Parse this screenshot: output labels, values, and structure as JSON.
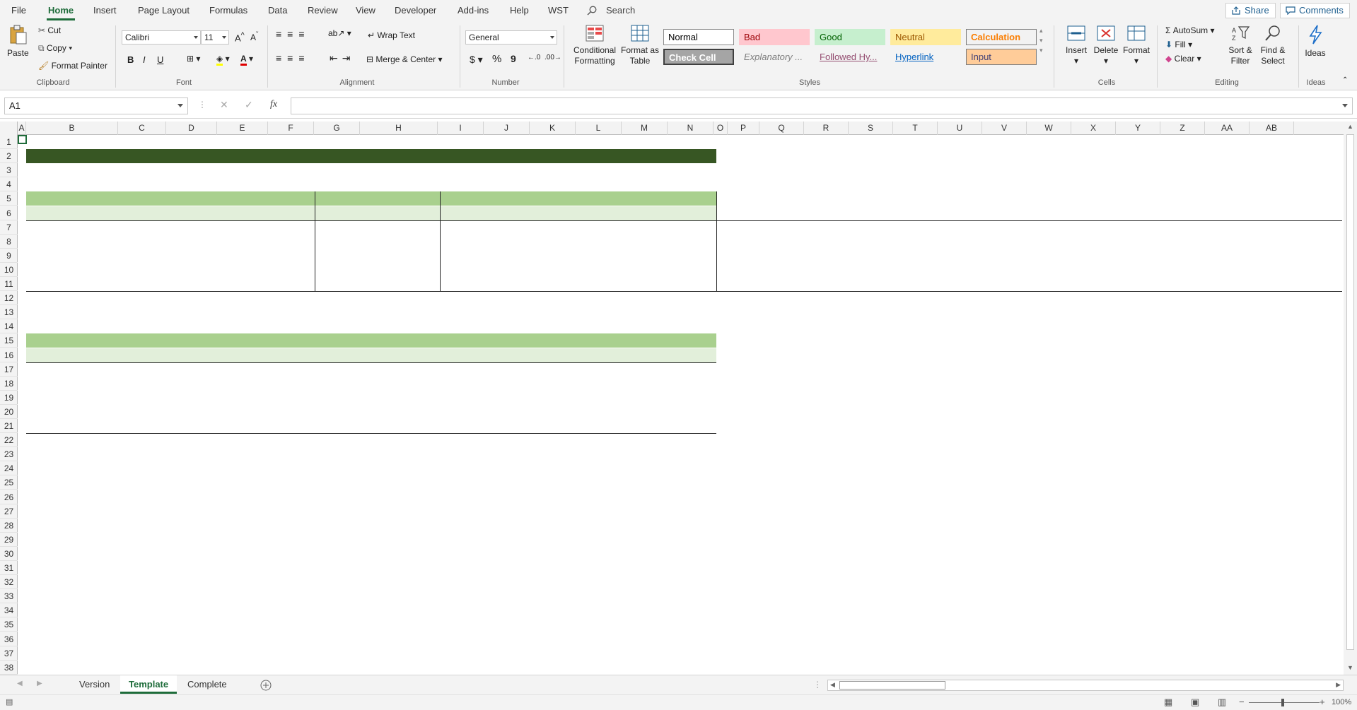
{
  "menu": {
    "items": [
      "File",
      "Home",
      "Insert",
      "Page Layout",
      "Formulas",
      "Data",
      "Review",
      "View",
      "Developer",
      "Add-ins",
      "Help",
      "WST"
    ],
    "active": "Home",
    "search_label": "Search",
    "share_label": "Share",
    "comments_label": "Comments"
  },
  "ribbon": {
    "clipboard": {
      "label": "Clipboard",
      "paste": "Paste",
      "cut": "Cut",
      "copy": "Copy",
      "format_painter": "Format Painter"
    },
    "font": {
      "label": "Font",
      "family": "Calibri",
      "size": "11",
      "bold": "B",
      "italic": "I",
      "underline": "U"
    },
    "alignment": {
      "label": "Alignment",
      "wrap_text": "Wrap Text",
      "merge_center": "Merge & Center"
    },
    "number": {
      "label": "Number",
      "format": "General",
      "currency": "$",
      "percent": "%",
      "comma": "9"
    },
    "styles": {
      "label": "Styles",
      "conditional_formatting": [
        "Conditional",
        "Formatting"
      ],
      "format_as_table": [
        "Format as",
        "Table"
      ],
      "cells": [
        {
          "name": "Normal",
          "bg": "#ffffff",
          "fg": "#000000"
        },
        {
          "name": "Bad",
          "bg": "#ffc7ce",
          "fg": "#9c0006"
        },
        {
          "name": "Good",
          "bg": "#c6efce",
          "fg": "#006100"
        },
        {
          "name": "Neutral",
          "bg": "#ffeb9c",
          "fg": "#9c5700"
        },
        {
          "name": "Calculation",
          "bg": "#f2f2f2",
          "fg": "#fa7d00"
        },
        {
          "name": "Check Cell",
          "bg": "#a5a5a5",
          "fg": "#ffffff"
        },
        {
          "name": "Explanatory ...",
          "bg": "#f3f3f3",
          "fg": "#7f7f7f"
        },
        {
          "name": "Followed Hy...",
          "bg": "#f3f3f3",
          "fg": "#954f72"
        },
        {
          "name": "Hyperlink",
          "bg": "#f3f3f3",
          "fg": "#0563c1"
        },
        {
          "name": "Input",
          "bg": "#ffcc99",
          "fg": "#3f3f76"
        }
      ]
    },
    "cells": {
      "label": "Cells",
      "insert": "Insert",
      "delete": "Delete",
      "format": "Format"
    },
    "editing": {
      "label": "Editing",
      "autosum": "AutoSum",
      "fill": "Fill",
      "clear": "Clear",
      "sort_filter": [
        "Sort &",
        "Filter"
      ],
      "find_select": [
        "Find &",
        "Select"
      ]
    },
    "ideas": {
      "label": "Ideas",
      "button": "Ideas"
    }
  },
  "formula_bar": {
    "name_box": "A1",
    "fx": "fx",
    "content": ""
  },
  "sheet": {
    "columns": [
      "A",
      "B",
      "C",
      "D",
      "E",
      "F",
      "G",
      "H",
      "I",
      "J",
      "K",
      "L",
      "M",
      "N",
      "O",
      "P",
      "Q",
      "R",
      "S",
      "T",
      "U",
      "V",
      "W",
      "X",
      "Y",
      "Z",
      "AA",
      "AB"
    ],
    "rows": [
      "1",
      "2",
      "3",
      "4",
      "5",
      "6",
      "7",
      "8",
      "9",
      "10",
      "11",
      "12",
      "13",
      "14",
      "15",
      "16",
      "17",
      "18",
      "19",
      "20",
      "21",
      "22",
      "23",
      "24",
      "25",
      "26",
      "27",
      "28",
      "29",
      "30",
      "31",
      "32",
      "33",
      "34",
      "35",
      "36",
      "37",
      "38"
    ],
    "colors": {
      "dark_green": "#375623",
      "mid_green": "#a9d08e",
      "light_green": "#e2efda",
      "accent": "#1e6c3a"
    }
  },
  "tabs": {
    "items": [
      "Version",
      "Template",
      "Complete"
    ],
    "active": "Template"
  },
  "status": {
    "zoom": "100%"
  }
}
